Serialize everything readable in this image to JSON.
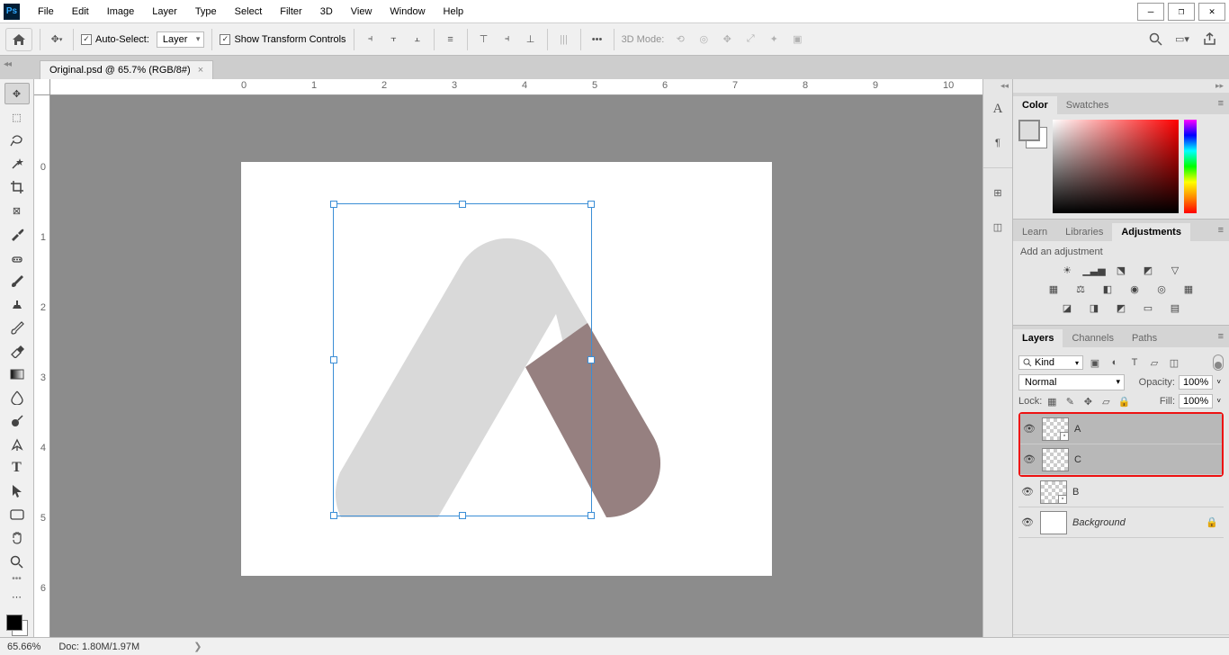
{
  "menu": {
    "items": [
      "File",
      "Edit",
      "Image",
      "Layer",
      "Type",
      "Select",
      "Filter",
      "3D",
      "View",
      "Window",
      "Help"
    ]
  },
  "options": {
    "autoSelectLabel": "Auto-Select:",
    "autoSelectValue": "Layer",
    "showTransformLabel": "Show Transform Controls",
    "mode3dLabel": "3D Mode:"
  },
  "document": {
    "tabTitle": "Original.psd @ 65.7% (RGB/8#)"
  },
  "rulerH": [
    "0",
    "1",
    "2",
    "3",
    "4",
    "5",
    "6",
    "7",
    "8",
    "9",
    "10"
  ],
  "rulerV": [
    "0",
    "1",
    "2",
    "3",
    "4",
    "5",
    "6"
  ],
  "colorPanel": {
    "tabs": [
      "Color",
      "Swatches"
    ]
  },
  "adjPanel": {
    "tabs": [
      "Learn",
      "Libraries",
      "Adjustments"
    ],
    "addLabel": "Add an adjustment"
  },
  "layersPanel": {
    "tabs": [
      "Layers",
      "Channels",
      "Paths"
    ],
    "searchKind": "Kind",
    "blendMode": "Normal",
    "opacityLabel": "Opacity:",
    "opacityValue": "100%",
    "lockLabel": "Lock:",
    "fillLabel": "Fill:",
    "fillValue": "100%",
    "layers": [
      {
        "name": "A",
        "selected": true,
        "smart": true,
        "group": "sel"
      },
      {
        "name": "C",
        "selected": true,
        "smart": false,
        "group": "sel"
      },
      {
        "name": "B",
        "selected": false,
        "smart": true,
        "group": null
      },
      {
        "name": "Background",
        "selected": false,
        "smart": false,
        "locked": true,
        "white": true,
        "italic": true
      }
    ]
  },
  "status": {
    "zoom": "65.66%",
    "doc": "Doc: 1.80M/1.97M"
  },
  "colors": {
    "shapeA": "#d9d9d9",
    "shapeB": "#968080"
  }
}
